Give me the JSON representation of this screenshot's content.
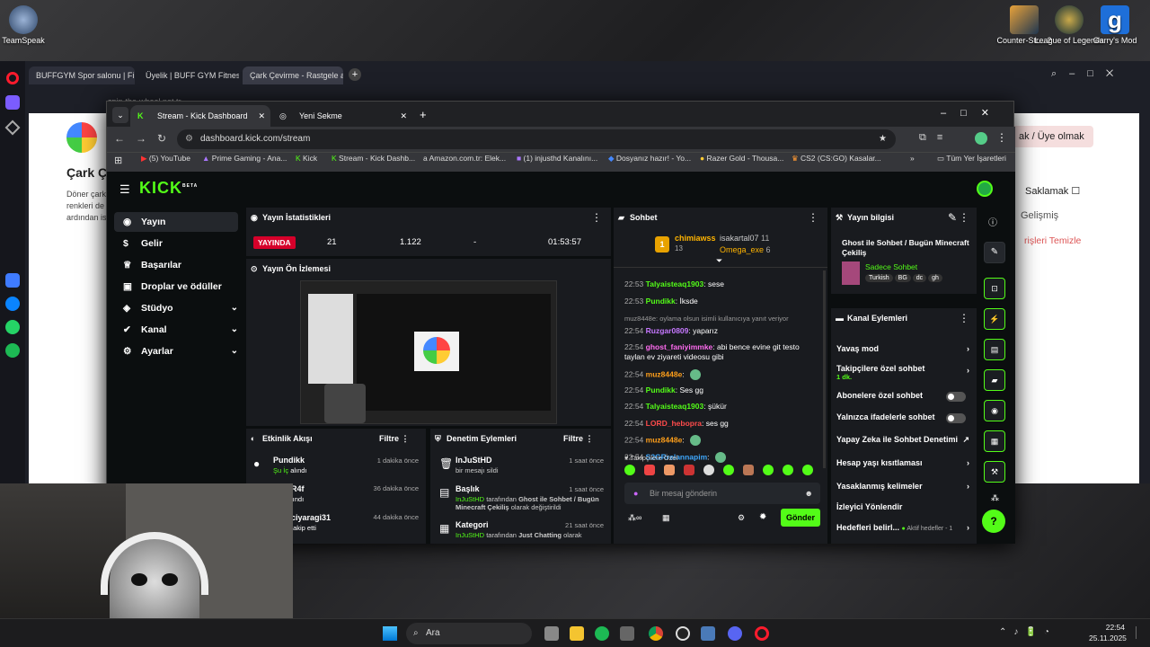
{
  "desktop": {
    "icons": [
      {
        "label": "TeamSpeak"
      },
      {
        "label": "Counter-Str... 2"
      },
      {
        "label": "League of Legends"
      },
      {
        "label": "Garry's Mod"
      }
    ]
  },
  "opera": {
    "tabs": [
      "BUFFGYM Spor salonu | Fi",
      "Üyelik | BUFF GYM Fitness",
      "Çark Çevirme - Rastgele a"
    ],
    "url": "spin-the-wheel.net.tr",
    "page": {
      "title": "Çark Ç",
      "body1": "Döner çark",
      "body2": "renkleri de",
      "body3": "ardından is",
      "member": "ak / Üye olmak",
      "hide": "Saklamak",
      "advanced": "Gelişmiş",
      "clear": "rişleri Temizle"
    }
  },
  "chrome": {
    "tabs": [
      "Stream - Kick Dashboard",
      "Yeni Sekme"
    ],
    "url": "dashboard.kick.com/stream",
    "bookmarks": [
      "(5) YouTube",
      "Prime Gaming - Ana...",
      "Kick",
      "Stream - Kick Dashb...",
      "Amazon.com.tr: Elek...",
      "(1) injusthd Kanalını...",
      "Dosyanız hazır! - Yo...",
      "Razer Gold - Thousa...",
      "CS2 (CS:GO) Kasalar..."
    ],
    "all_bookmarks": "Tüm Yer İşaretleri"
  },
  "kick": {
    "logo": "KICK",
    "logo_sup": "BETA",
    "nav": [
      {
        "label": "Yayın"
      },
      {
        "label": "Gelir"
      },
      {
        "label": "Başarılar"
      },
      {
        "label": "Droplar ve ödüller"
      },
      {
        "label": "Stüdyo"
      },
      {
        "label": "Kanal"
      },
      {
        "label": "Ayarlar"
      }
    ],
    "stats": {
      "title": "Yayın İstatistikleri",
      "live": "YAYINDA",
      "viewers": "21",
      "followers": "1.122",
      "subs": "-",
      "duration": "01:53:57"
    },
    "preview": {
      "title": "Yayın Ön İzlemesi"
    },
    "activity": {
      "title": "Etkinlik Akışı",
      "filter": "Filtre",
      "items": [
        {
          "user": "Pundikk",
          "action": "Şu İç",
          "action2": "alındı",
          "time": "1 dakika önce"
        },
        {
          "user": "R4f",
          "action": "lındı",
          "time": "36 dakika önce"
        },
        {
          "user": "ciyaragi31",
          "action": "takip etti",
          "time": "44 dakika önce"
        }
      ]
    },
    "audit": {
      "title": "Denetim Eylemleri",
      "filter": "Filtre",
      "items": [
        {
          "title": "InJuStHD",
          "desc": "bir mesajı sildi",
          "time": "1 saat önce"
        },
        {
          "title": "Başlık",
          "who": "InJuStHD",
          "mid": "tarafından",
          "val": "Ghost ile Sohbet / Bugün Minecraft Çekiliş",
          "end": "olarak değiştirildi",
          "time": "1 saat önce"
        },
        {
          "title": "Kategori",
          "who": "InJuStHD",
          "mid": "tarafından",
          "val": "Just Chatting",
          "end": "olarak",
          "time": "21 saat önce"
        }
      ]
    },
    "chat": {
      "title": "Sohbet",
      "top": [
        {
          "name": "chimiawss",
          "count": "13"
        },
        {
          "name": "isakartal07",
          "count": "11"
        },
        {
          "name": "Omega_exe",
          "count": "6"
        }
      ],
      "messages": [
        {
          "t": "22:53",
          "u": "Talyaisteaq1903",
          "c": "#53fc18",
          "m": "sese"
        },
        {
          "t": "22:53",
          "u": "Pundikk",
          "c": "#53fc18",
          "m": "İksde"
        },
        {
          "t": "",
          "u": "",
          "c": "#aaa",
          "m": "muz8448e: oylama olsun isimli kullanıcıya yanıt veriyor"
        },
        {
          "t": "22:54",
          "u": "Ruzgar0809",
          "c": "#c678ff",
          "m": "yaparız"
        },
        {
          "t": "22:54",
          "u": "ghost_faniyimmke",
          "c": "#ff6bf0",
          "m": "abi bence evine git testo taylan ev ziyareti videosu gibi"
        },
        {
          "t": "22:54",
          "u": "muz8448e",
          "c": "#ff9f1a",
          "m": ""
        },
        {
          "t": "22:54",
          "u": "Pundikk",
          "c": "#53fc18",
          "m": "Ses gg"
        },
        {
          "t": "22:54",
          "u": "Talyaisteaq1903",
          "c": "#53fc18",
          "m": "şükür"
        },
        {
          "t": "22:54",
          "u": "LORD_hebopra",
          "c": "#ff4b4b",
          "m": "ses gg"
        },
        {
          "t": "22:54",
          "u": "muz8448e",
          "c": "#ff9f1a",
          "m": ""
        },
        {
          "t": "22:54",
          "u": "S2GRrelannapim",
          "c": "#3fa9ff",
          "m": ""
        }
      ],
      "followers_only": "Takipçilere Özel",
      "placeholder": "Bir mesaj gönderin",
      "send": "Gönder"
    },
    "info": {
      "title": "Yayın bilgisi",
      "stream_title": "Ghost ile Sohbet / Bugün Minecraft Çekiliş",
      "category": "Sadece Sohbet",
      "tags": [
        "Turkish",
        "BG",
        "dc",
        "gh"
      ]
    },
    "actions": {
      "title": "Kanal Eylemleri",
      "items": [
        {
          "label": "Yavaş mod"
        },
        {
          "label": "Takipçilere özel sohbet",
          "sub": "1 dk."
        },
        {
          "label": "Abonelere özel sohbet"
        },
        {
          "label": "Yalnızca ifadelerle sohbet"
        },
        {
          "label": "Yapay Zeka ile Sohbet Denetimi"
        },
        {
          "label": "Hesap yaşı kısıtlaması"
        },
        {
          "label": "Yasaklanmış kelimeler"
        },
        {
          "label": "İzleyici Yönlendir"
        },
        {
          "label": "Hedefleri belirl...",
          "sub": "Aktif hedefler - 1"
        }
      ]
    }
  },
  "taskbar": {
    "search": "Ara",
    "time": "22:54",
    "date": "25.11.2025"
  }
}
